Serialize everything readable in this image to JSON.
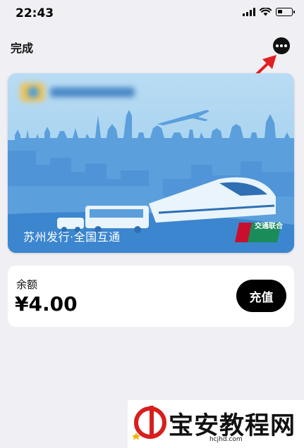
{
  "status_bar": {
    "time": "22:43"
  },
  "header": {
    "done_label": "完成"
  },
  "card": {
    "slogan": "苏州发行·全国互通",
    "network_text": "交通联合"
  },
  "balance": {
    "label": "余额",
    "value": "¥4.00",
    "recharge_label": "充值"
  },
  "watermark": {
    "site_name": "宝安教程网",
    "site_url": "hcjhd.com"
  },
  "colors": {
    "background": "#f0eff4",
    "card_blue": "#5b9fdc",
    "annotation_red": "#e02020",
    "unionpay_red": "#c8102e",
    "unionpay_green": "#1a8c5a"
  }
}
